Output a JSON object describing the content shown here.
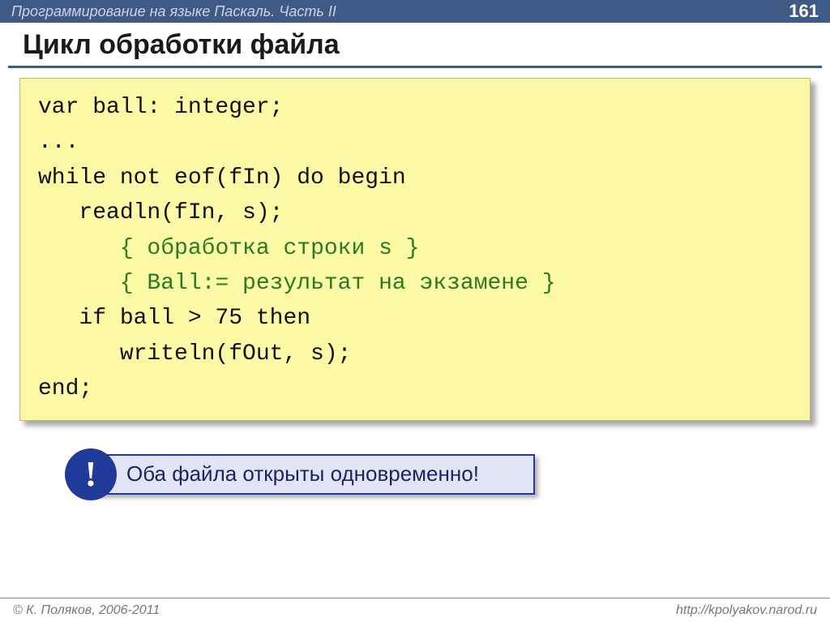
{
  "topbar": {
    "subject": "Программирование на языке Паскаль. Часть II",
    "pagenum": "161"
  },
  "title": "Цикл обработки файла",
  "code": {
    "l1": "var ball: integer;",
    "l2": "...",
    "l3": "while not eof(fIn) do begin",
    "l4": "   readln(fIn, s);",
    "l5a": "      ",
    "l5b": "{ обработка строки s }",
    "l6a": "      ",
    "l6b": "{ Ball:= результат на экзамене }",
    "l7": "   if ball > 75 then",
    "l8": "      writeln(fOut, s);",
    "l9": "end;"
  },
  "callout": {
    "bang": "!",
    "text": "Оба файла открыты одновременно!"
  },
  "footer": {
    "copyright": "© К. Поляков, 2006-2011",
    "url": "http://kpolyakov.narod.ru"
  }
}
